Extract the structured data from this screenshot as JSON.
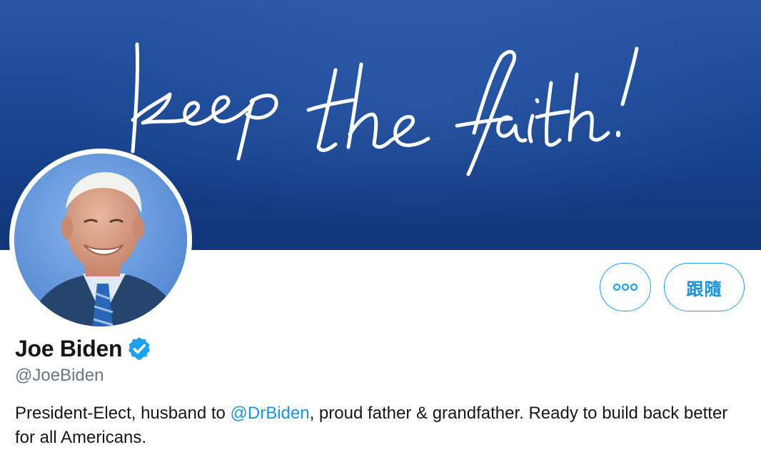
{
  "banner": {
    "script_text": "keep the faith!",
    "colors": {
      "top": "#2a57a6",
      "bottom": "#113576",
      "ink": "#ffffff"
    }
  },
  "profile": {
    "display_name": "Joe Biden",
    "handle": "@JoeBiden",
    "verified": true,
    "bio": {
      "before_mention": "President-Elect, husband to ",
      "mention": "@DrBiden",
      "after_mention": ", proud father & grandfather. Ready to build back better for all Americans."
    }
  },
  "actions": {
    "more_icon": "more-dots-icon",
    "follow_label": "跟隨"
  },
  "colors": {
    "accent": "#1da1f2",
    "mention": "#1b95e0",
    "name": "#14171a",
    "handle": "#657786"
  }
}
